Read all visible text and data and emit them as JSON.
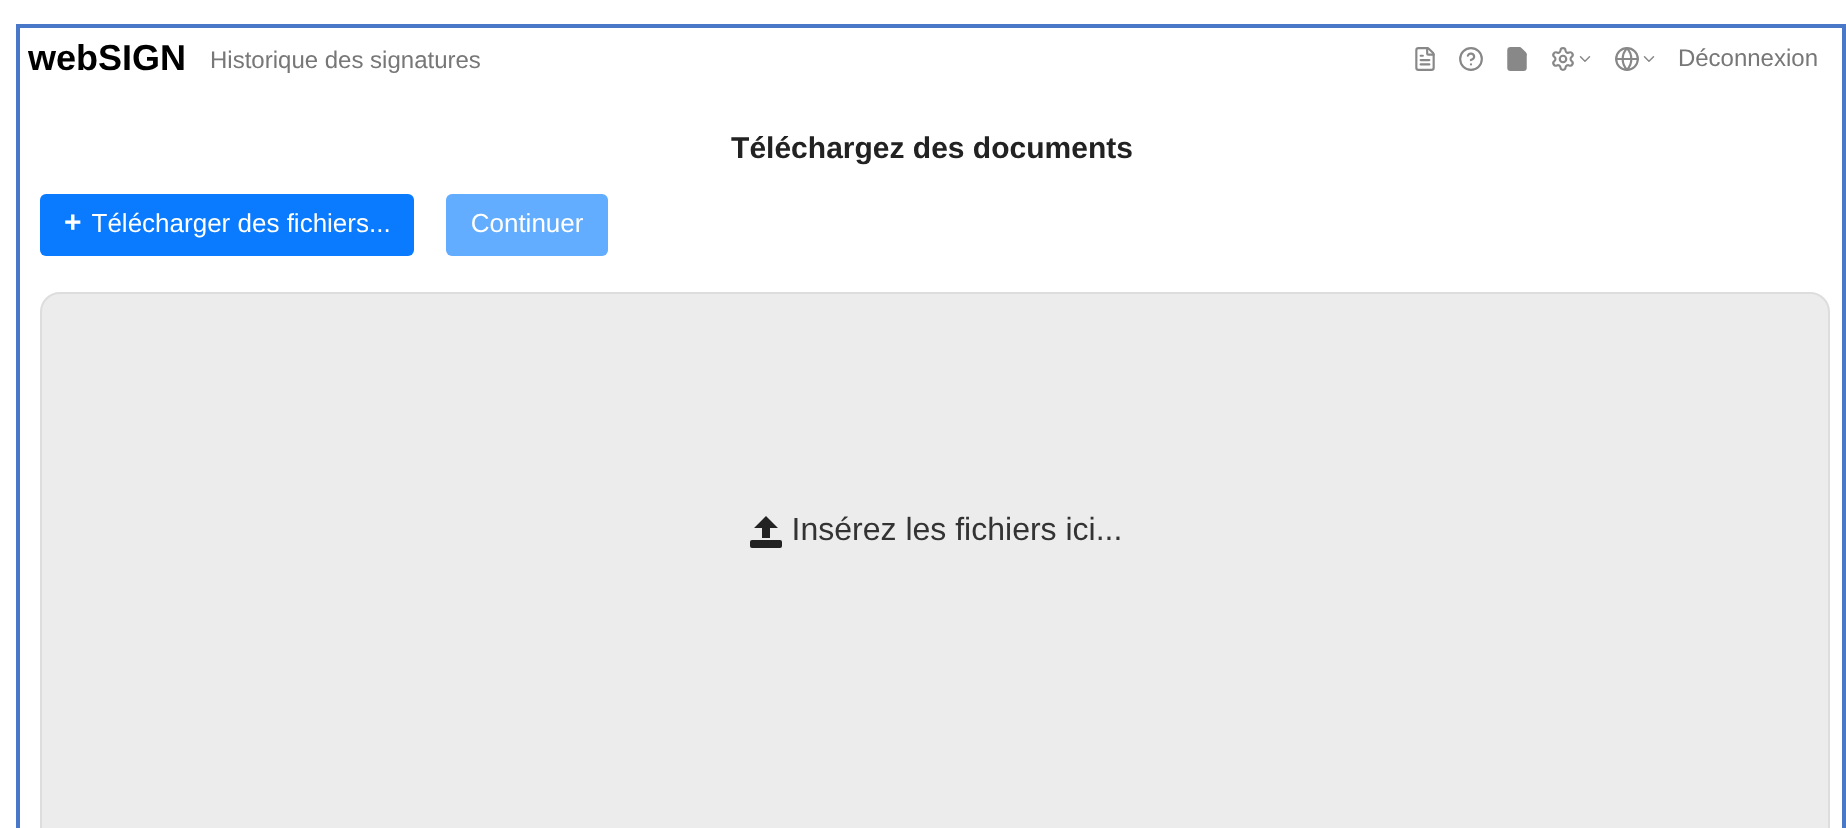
{
  "navbar": {
    "brand": "webSIGN",
    "link": "Historique des signatures",
    "logout": "Déconnexion"
  },
  "page": {
    "title": "Téléchargez des documents"
  },
  "buttons": [
    {
      "label": "+",
      "text": "Télécharger des fichiers...",
      "disabled": false
    },
    {
      "text": "Continuer",
      "disabled": true
    }
  ],
  "dropzone": {
    "text": "Insérez les fichiers ici..."
  }
}
